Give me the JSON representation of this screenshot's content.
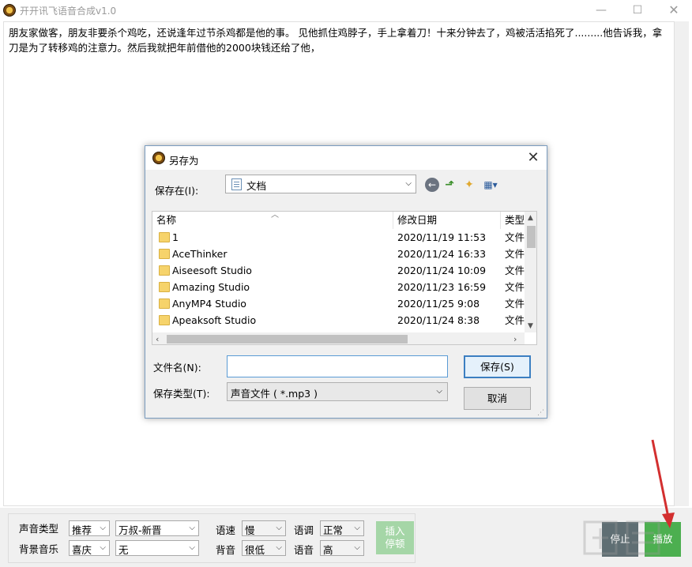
{
  "app": {
    "title": "开开讯飞语音合成v1.0",
    "window_controls": {
      "minimize": "—",
      "maximize": "☐",
      "close": "✕"
    }
  },
  "editor": {
    "text": "朋友家做客，朋友非要杀个鸡吃，还说逢年过节杀鸡都是他的事。 见他抓住鸡脖子，手上拿着刀！十来分钟去了，鸡被活活掐死了.........他告诉我，拿刀是为了转移鸡的注意力。然后我就把年前借他的2000块钱还给了他，"
  },
  "controls": {
    "voice_type_label": "声音类型",
    "voice_type_value": "推荐",
    "voice_name_value": "万叔-新晋",
    "bg_music_label": "背景音乐",
    "bg_music_value": "喜庆",
    "bg_music_track_value": "无",
    "speed_label": "语速",
    "speed_value": "慢",
    "tone_label": "语调",
    "tone_value": "正常",
    "bg_volume_label": "背音",
    "bg_volume_value": "很低",
    "volume_label": "语音",
    "volume_value": "高",
    "insert_pause_label": "插入停顿",
    "stop_label": "停止",
    "play_label": "播放"
  },
  "dialog": {
    "title": "另存为",
    "close": "✕",
    "save_in_label": "保存在(I):",
    "save_in_value": "文档",
    "columns": {
      "name": "名称",
      "date": "修改日期",
      "type": "类型"
    },
    "files": [
      {
        "name": "1",
        "date": "2020/11/19 11:53",
        "type": "文件"
      },
      {
        "name": "AceThinker",
        "date": "2020/11/24 16:33",
        "type": "文件"
      },
      {
        "name": "Aiseesoft Studio",
        "date": "2020/11/24 10:09",
        "type": "文件"
      },
      {
        "name": "Amazing Studio",
        "date": "2020/11/23 16:59",
        "type": "文件"
      },
      {
        "name": "AnyMP4 Studio",
        "date": "2020/11/25 9:08",
        "type": "文件"
      },
      {
        "name": "Apeaksoft Studio",
        "date": "2020/11/24 8:38",
        "type": "文件"
      }
    ],
    "filename_label": "文件名(N):",
    "filename_value": "",
    "filetype_label": "保存类型(T):",
    "filetype_value": "声音文件 ( *.mp3 )",
    "save_button": "保存(S)",
    "cancel_button": "取消"
  },
  "colors": {
    "stop_button": "#5f6e73",
    "play_button": "#4caf50",
    "insert_button": "#a5d6a7",
    "annotation_arrow": "#d32f2f"
  }
}
